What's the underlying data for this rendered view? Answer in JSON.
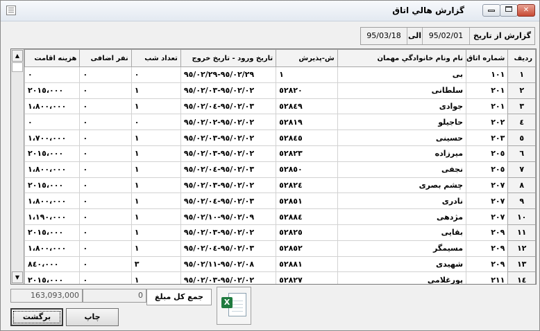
{
  "window": {
    "title": "گزارش هالي اتاق"
  },
  "controls": {
    "minimize": "",
    "maximize": "",
    "close": "✕"
  },
  "date_filter": {
    "label": "گزارش از تاريخ",
    "from": "95/02/01",
    "to_label": "الی",
    "to": "95/03/18"
  },
  "table": {
    "headers": [
      "رديف",
      "شماره اتاق",
      "نام ونام خانوادگي مهمان",
      "ش-پذيرش",
      "تاريخ ورود - تاريخ خروج",
      "تعداد شب",
      "نفر اضافی",
      "هزينه اقامت"
    ],
    "rows": [
      [
        "١",
        "١٠١",
        "بی",
        "١",
        "٩٥/٠٢/٢٩-٩٥/٠٢/٢٩",
        "٠",
        "٠",
        "٠"
      ],
      [
        "٢",
        "٢٠١",
        "سلطانی",
        "٥٢٨٢٠",
        "٩٥/٠٢/٠٢-٩٥/٠٢/٠٣",
        "١",
        "٠",
        "٢٠١٥،٠٠٠"
      ],
      [
        "٣",
        "٢٠١",
        "جوادی",
        "٥٢٨٤٩",
        "٩٥/٠٢/٠٣-٩٥/٠٢/٠٤",
        "١",
        "٠",
        "١،٨٠٠،٠٠٠"
      ],
      [
        "٤",
        "٢٠٢",
        "حاجيلو",
        "٥٢٨١٩",
        "٩٥/٠٢/٠٢-٩٥/٠٢/٠٢",
        "٠",
        "٠",
        "٠"
      ],
      [
        "٥",
        "٢٠٣",
        "حسينی",
        "٥٢٨٤٥",
        "٩٥/٠٢/٠٢-٩٥/٠٢/٠٣",
        "١",
        "٠",
        "١،٧٠٠،٠٠٠"
      ],
      [
        "٦",
        "٢٠٥",
        "ميرزاده",
        "٥٢٨٢٣",
        "٩٥/٠٢/٠٢-٩٥/٠٢/٠٣",
        "١",
        "٠",
        "٢٠١٥،٠٠٠"
      ],
      [
        "٧",
        "٢٠٥",
        "نجفی",
        "٥٢٨٥٠",
        "٩٥/٠٢/٠٣-٩٥/٠٢/٠٤",
        "١",
        "٠",
        "١،٨٠٠،٠٠٠"
      ],
      [
        "٨",
        "٢٠٧",
        "چشم بصری",
        "٥٢٨٢٤",
        "٩٥/٠٢/٠٢-٩٥/٠٢/٠٣",
        "١",
        "٠",
        "٢٠١٥،٠٠٠"
      ],
      [
        "٩",
        "٢٠٧",
        "نادری",
        "٥٢٨٥١",
        "٩٥/٠٢/٠٣-٩٥/٠٢/٠٤",
        "١",
        "٠",
        "١،٨٠٠،٠٠٠"
      ],
      [
        "١٠",
        "٢٠٧",
        "مژدهی",
        "٥٢٨٨٤",
        "٩٥/٠٢/٠٩-٩٥/٠٢/١٠",
        "١",
        "٠",
        "١،١٩٠،٠٠٠"
      ],
      [
        "١١",
        "٢٠٩",
        "بقايی",
        "٥٢٨٢٥",
        "٩٥/٠٢/٠٢-٩٥/٠٢/٠٣",
        "١",
        "٠",
        "٢٠١٥،٠٠٠"
      ],
      [
        "١٢",
        "٢٠٩",
        "مسيمگر",
        "٥٢٨٥٢",
        "٩٥/٠٢/٠٣-٩٥/٠٢/٠٤",
        "١",
        "٠",
        "١،٨٠٠،٠٠٠"
      ],
      [
        "١٣",
        "٢٠٩",
        "شهيدی",
        "٥٢٨٨١",
        "٩٥/٠٢/٠٨-٩٥/٠٢/١١",
        "٣",
        "٠",
        "٨٤٠،٠٠٠"
      ],
      [
        "١٤",
        "٢١١",
        "پورغلامی",
        "٥٢٨٢٧",
        "٩٥/٠٢/٠٢-٩٥/٠٢/٠٣",
        "١",
        "٠",
        "٢٠١٥،٠٠٠"
      ]
    ]
  },
  "footer": {
    "total_amount": "163,093,000",
    "count": "0",
    "total_label": "جمع کل مبلغ",
    "back_button": "برگشت",
    "print_button": "چاپ",
    "excel_badge": "X"
  },
  "icons": {
    "scroll_up": "scroll-up-arrow-icon",
    "scroll_down": "scroll-down-arrow-icon",
    "excel": "excel-export-icon"
  },
  "colors": {
    "excel_green": "#1f7a3f",
    "close_red": "#c74a34"
  }
}
